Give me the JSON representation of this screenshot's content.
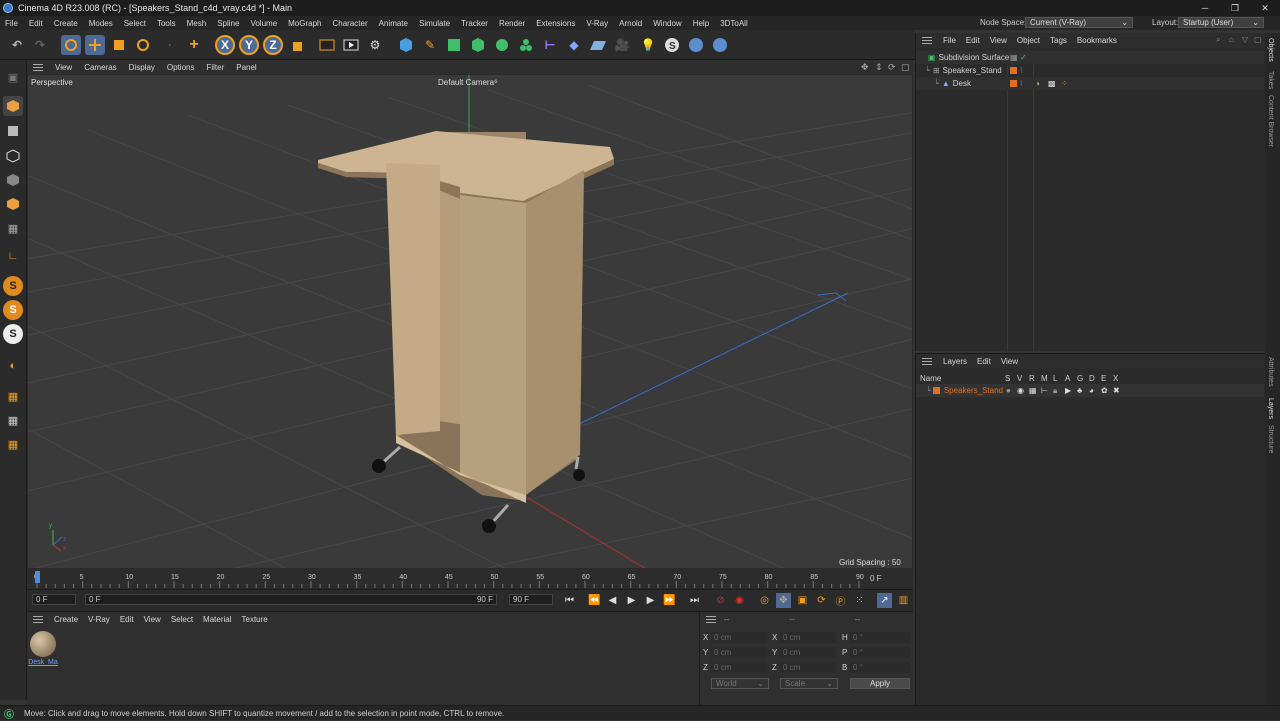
{
  "titlebar": {
    "title": "Cinema 4D R23.008 (RC) - [Speakers_Stand_c4d_vray.c4d *] - Main",
    "minimize": "─",
    "maximize": "❐",
    "close": "✕"
  },
  "menu": [
    "File",
    "Edit",
    "Create",
    "Modes",
    "Select",
    "Tools",
    "Mesh",
    "Spline",
    "Volume",
    "MoGraph",
    "Character",
    "Animate",
    "Simulate",
    "Tracker",
    "Render",
    "Extensions",
    "V-Ray",
    "Arnold",
    "Window",
    "Help",
    "3DToAll"
  ],
  "node_space": {
    "label": "Node Space:",
    "value": "Current (V-Ray)"
  },
  "layout": {
    "label": "Layout:",
    "value": "Startup (User)"
  },
  "toolbar": {
    "x_label": "X",
    "y_label": "Y",
    "z_label": "Z"
  },
  "left_tools": {
    "s1": "S",
    "s2": "S",
    "s3": "S"
  },
  "viewport_menu": [
    "View",
    "Cameras",
    "Display",
    "Options",
    "Filter",
    "Panel"
  ],
  "viewport": {
    "name": "Perspective",
    "camera": "Default Camera",
    "grid_spacing": "Grid Spacing : 50 cm",
    "axis_x": "x",
    "axis_y": "y",
    "axis_z": "z"
  },
  "timeline": {
    "ticks": [
      "0",
      "5",
      "10",
      "15",
      "20",
      "25",
      "30",
      "35",
      "40",
      "45",
      "50",
      "55",
      "60",
      "65",
      "70",
      "75",
      "80",
      "85",
      "90"
    ],
    "current_frame": "0 F",
    "max_frames": 90
  },
  "transport": {
    "start": "0 F",
    "range_start": "0 F",
    "range_end": "90 F",
    "end": "90 F"
  },
  "material_menu": [
    "Create",
    "V-Ray",
    "Edit",
    "View",
    "Select",
    "Material",
    "Texture"
  ],
  "material": {
    "name": "Desk_Ma"
  },
  "coords": {
    "rows": [
      {
        "a": "X",
        "av": "0 cm",
        "b": "X",
        "bv": "0 cm",
        "c": "H",
        "cv": "0 °"
      },
      {
        "a": "Y",
        "av": "0 cm",
        "b": "Y",
        "bv": "0 cm",
        "c": "P",
        "cv": "0 °"
      },
      {
        "a": "Z",
        "av": "0 cm",
        "b": "Z",
        "bv": "0 cm",
        "c": "B",
        "cv": "0 °"
      }
    ],
    "headers": [
      "--",
      "--",
      "--"
    ],
    "world": "World",
    "scale": "Scale",
    "apply": "Apply"
  },
  "objects": {
    "menu": [
      "File",
      "Edit",
      "View",
      "Object",
      "Tags",
      "Bookmarks"
    ],
    "items": [
      {
        "name": "Subdivision Surface"
      },
      {
        "name": "Speakers_Stand"
      },
      {
        "name": "Desk"
      }
    ]
  },
  "layers": {
    "menu": [
      "Layers",
      "Edit",
      "View"
    ],
    "header_name": "Name",
    "flags": [
      "S",
      "V",
      "R",
      "M",
      "L",
      "A",
      "G",
      "D",
      "E",
      "X"
    ],
    "items": [
      {
        "name": "Speakers_Stand",
        "color": "#e07020"
      }
    ]
  },
  "side_tabs": [
    "Objects",
    "Takes",
    "Content Browser",
    "Attributes",
    "Layers",
    "Structure"
  ],
  "status": {
    "text": "Move: Click and drag to move elements. Hold down SHIFT to quantize movement / add to the selection in point mode, CTRL to remove."
  },
  "colors": {
    "accent": "#4c6a95",
    "orange": "#e07020",
    "wood": "#c4aa86"
  }
}
